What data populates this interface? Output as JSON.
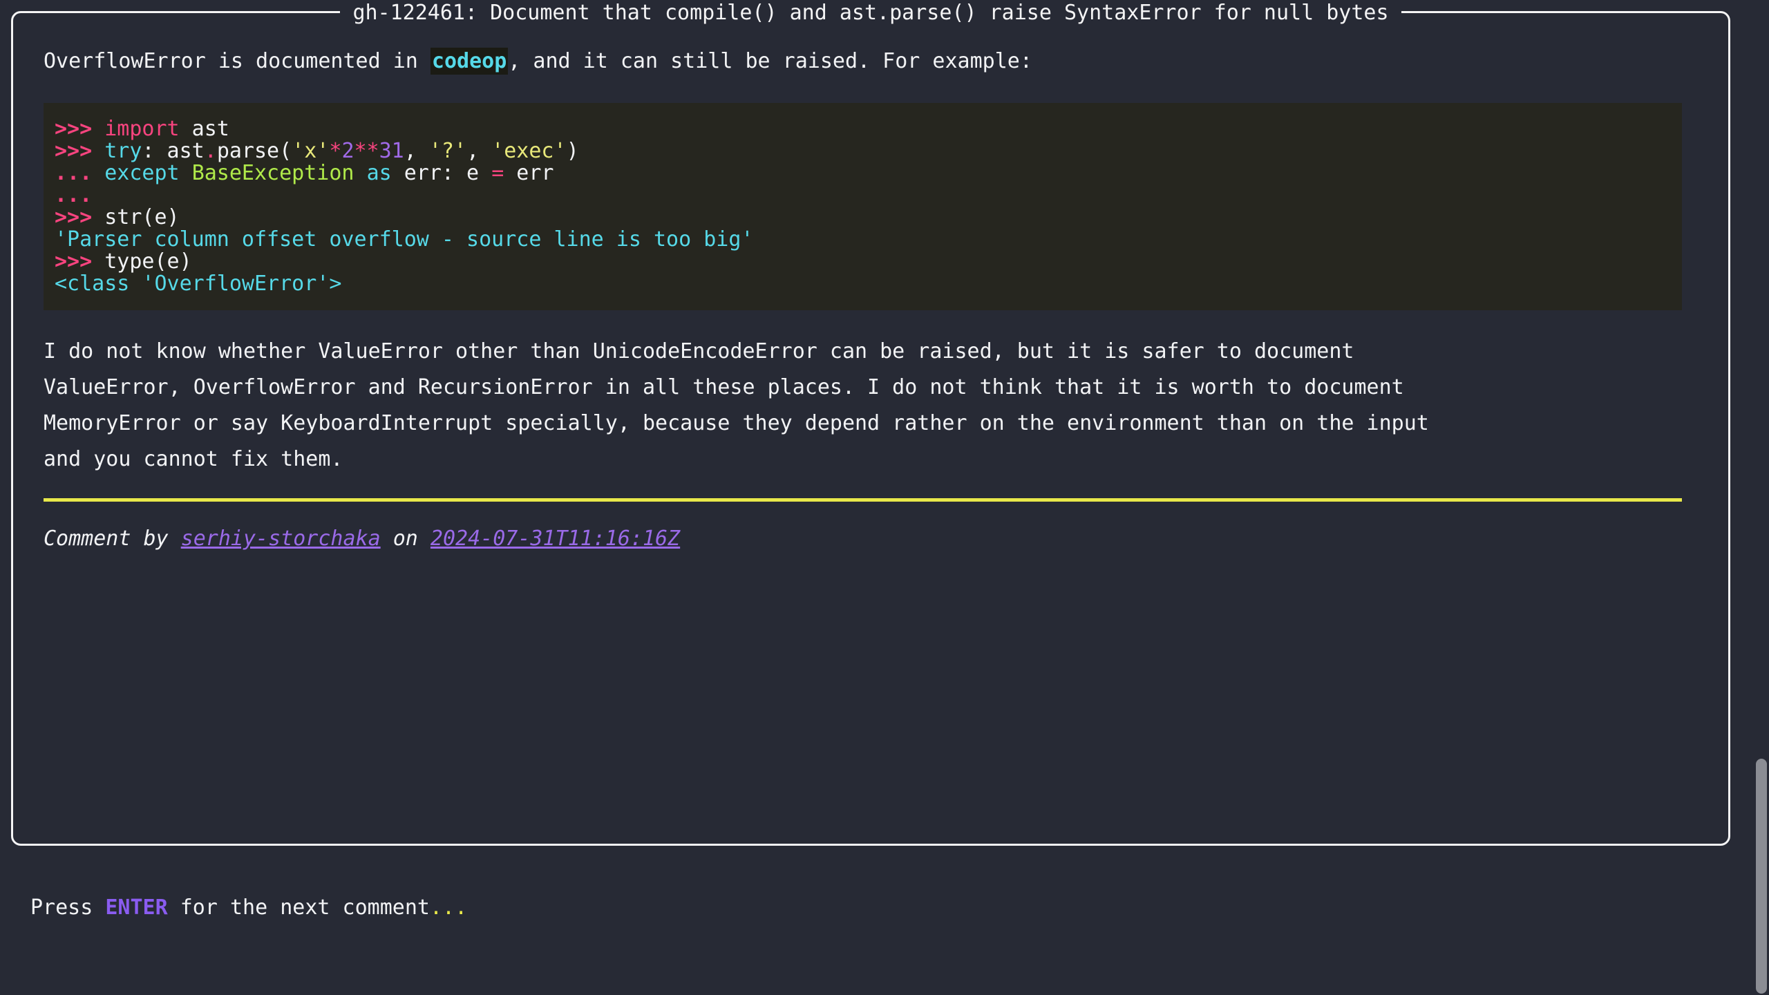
{
  "panel": {
    "title": "gh-122461: Document that compile() and ast.parse() raise SyntaxError for null bytes"
  },
  "intro": {
    "before": "OverflowError is documented in ",
    "code": "codeop",
    "after": ", and it can still be raised. For example:"
  },
  "codeblock": {
    "lines": [
      {
        "tokens": [
          {
            "text": ">>> ",
            "cls": "t-prompt"
          },
          {
            "text": "import",
            "cls": "t-kw"
          },
          {
            "text": " ast",
            "cls": "t-name"
          }
        ]
      },
      {
        "tokens": [
          {
            "text": ">>> ",
            "cls": "t-prompt"
          },
          {
            "text": "try",
            "cls": "t-kw2"
          },
          {
            "text": ": ast",
            "cls": "t-name"
          },
          {
            "text": ".",
            "cls": "t-op"
          },
          {
            "text": "parse(",
            "cls": "t-name"
          },
          {
            "text": "'x'",
            "cls": "t-str"
          },
          {
            "text": "*",
            "cls": "t-op"
          },
          {
            "text": "2",
            "cls": "t-num"
          },
          {
            "text": "**",
            "cls": "t-op"
          },
          {
            "text": "31",
            "cls": "t-num"
          },
          {
            "text": ", ",
            "cls": "t-punct"
          },
          {
            "text": "'?'",
            "cls": "t-str"
          },
          {
            "text": ", ",
            "cls": "t-punct"
          },
          {
            "text": "'exec'",
            "cls": "t-str"
          },
          {
            "text": ")",
            "cls": "t-punct"
          }
        ]
      },
      {
        "tokens": [
          {
            "text": "... ",
            "cls": "t-prompt"
          },
          {
            "text": "except",
            "cls": "t-kw2"
          },
          {
            "text": " ",
            "cls": "t-punct"
          },
          {
            "text": "BaseException",
            "cls": "t-builtin"
          },
          {
            "text": " ",
            "cls": "t-punct"
          },
          {
            "text": "as",
            "cls": "t-kw2"
          },
          {
            "text": " err: e ",
            "cls": "t-name"
          },
          {
            "text": "=",
            "cls": "t-op"
          },
          {
            "text": " err",
            "cls": "t-name"
          }
        ]
      },
      {
        "tokens": [
          {
            "text": "... ",
            "cls": "t-prompt"
          }
        ]
      },
      {
        "tokens": [
          {
            "text": ">>> ",
            "cls": "t-prompt"
          },
          {
            "text": "str(e)",
            "cls": "t-name"
          }
        ]
      },
      {
        "tokens": [
          {
            "text": "'Parser column offset overflow - source line is too big'",
            "cls": "t-out"
          }
        ]
      },
      {
        "tokens": [
          {
            "text": ">>> ",
            "cls": "t-prompt"
          },
          {
            "text": "type(e)",
            "cls": "t-name"
          }
        ]
      },
      {
        "tokens": [
          {
            "text": "<class 'OverflowError'>",
            "cls": "t-out"
          }
        ]
      }
    ]
  },
  "paragraph": {
    "lines": [
      "I do not know whether ValueError other than UnicodeEncodeError can be raised, but it is safer to document",
      "ValueError, OverflowError and RecursionError in all these places. I do not think that it is worth to document",
      "MemoryError or say KeyboardInterrupt specially, because they depend rather on the environment than on the input",
      "and you cannot fix them."
    ]
  },
  "attribution": {
    "prefix": "Comment by ",
    "author": "serhiy-storchaka",
    "middle": " on ",
    "timestamp": "2024-07-31T11:16:16Z"
  },
  "bottom_prompt": {
    "before": "Press ",
    "key": "ENTER",
    "after": " for the next comment",
    "dots": "..."
  },
  "colors": {
    "background": "#272a35",
    "panel_border": "#f4f4f5",
    "code_background": "#26261f",
    "rule": "#e8e84a",
    "link": "#9a6ae8",
    "accent_prompt": "#f8447f",
    "accent_output": "#56d9e8",
    "scrollbar_thumb": "#8b8d94"
  }
}
